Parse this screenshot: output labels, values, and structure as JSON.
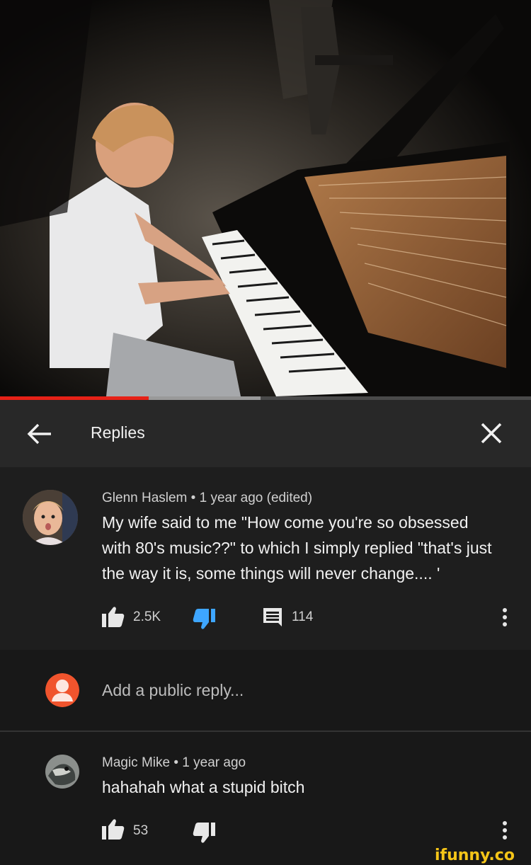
{
  "video": {
    "progress_played_fraction": 0.28,
    "progress_buffered_fraction": 0.49
  },
  "header": {
    "title": "Replies",
    "back_icon": "arrow-back-icon",
    "close_icon": "close-icon"
  },
  "main_comment": {
    "author": "Glenn Haslem",
    "time": "1 year ago (edited)",
    "meta_line": "Glenn Haslem • 1 year ago (edited)",
    "text_lines": [
      "My wife said to me \"How come you're so obsessed",
      "with 80's music??\" to which I simply replied \"that's just",
      "the way it is, some things will never change.... '"
    ],
    "likes": "2.5K",
    "replies": "114",
    "dislike_color": "#3ea6ff"
  },
  "add_reply": {
    "placeholder": "Add a public reply...",
    "avatar_color": "#f0542d"
  },
  "reply_comment": {
    "meta_line": "Magic Mike • 1 year ago",
    "text": "hahahah what a stupid bitch",
    "likes": "53"
  },
  "watermark": "ifunny.co"
}
